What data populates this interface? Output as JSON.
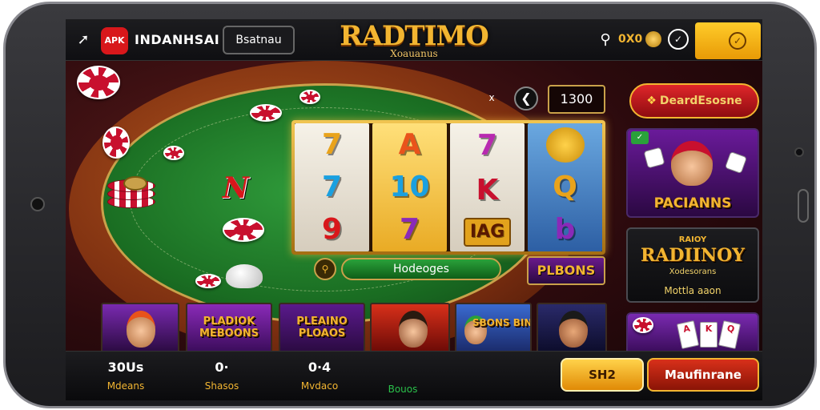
{
  "header": {
    "apk_badge": "APK",
    "app_name": "INDANHSAI",
    "sub_button": "Bsatnau",
    "logo_main": "RADTIMO",
    "logo_sub": "Xoauanus",
    "coin_text": "0X0",
    "back_icon": "back-arrow-icon",
    "search_icon": "search-icon"
  },
  "table": {
    "letter": "N"
  },
  "controls": {
    "x_label": "x",
    "back_label": "❮",
    "balance": "1300"
  },
  "slot": {
    "reels": [
      [
        "7",
        "7",
        "9"
      ],
      [
        "A",
        "10",
        "7"
      ],
      [
        "7",
        "K",
        "IAG"
      ],
      [
        "",
        "Q",
        "b"
      ]
    ],
    "bet_bar": "Hodeoges",
    "plays_label": "PLBONS"
  },
  "right": {
    "pill": "DeardEsosne",
    "card_a_title": "PACIANNS",
    "card_b_top": "RAIOY",
    "card_b_title": "RADIINOY",
    "card_b_sub": "Xodesorans",
    "card_b_foot": "Mottla aaon"
  },
  "thumbs": [
    {
      "text": ""
    },
    {
      "text": "PLADIOK MEBOONS"
    },
    {
      "text": "PLEAINO PLOAOS"
    },
    {
      "text": ""
    },
    {
      "text": "SBONS BINIA"
    },
    {
      "text": ""
    }
  ],
  "bottom": {
    "stat1_value": "30Us",
    "stat1_label": "Mdeans",
    "stat2_value": "0·",
    "stat2_label": "Shasos",
    "stat3_value": "0·4",
    "stat3_label": "Mvdaco",
    "stat4_label": "Bouos",
    "yellow_button": "SH2",
    "red_button": "Maufinrane"
  }
}
